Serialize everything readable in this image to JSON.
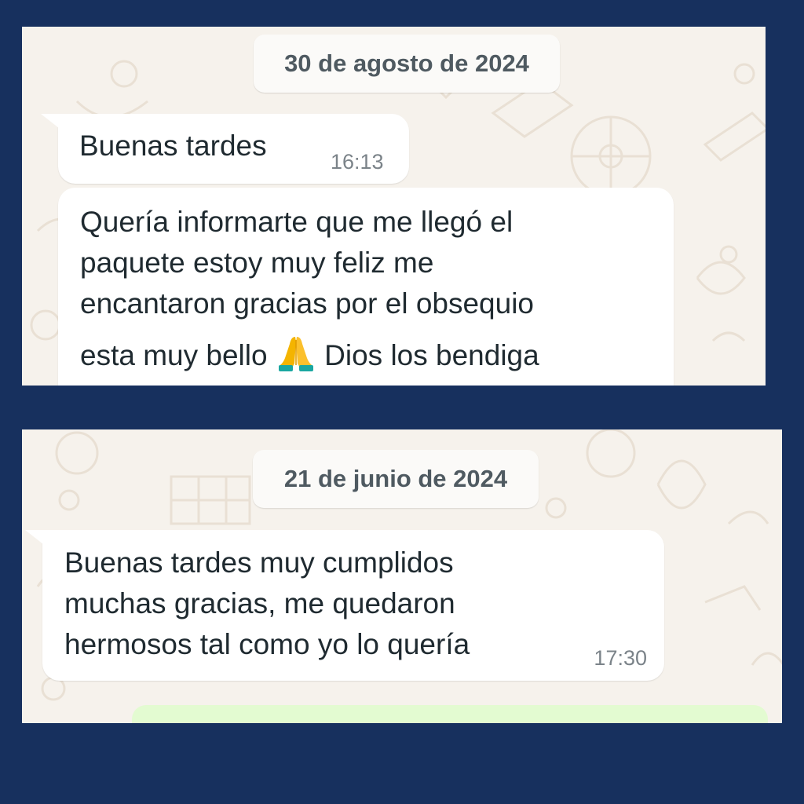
{
  "colors": {
    "frame_background": "#17305e",
    "chat_wallpaper": "#f6f2ec",
    "incoming_bubble": "#ffffff",
    "outgoing_bubble": "#e3fbd1",
    "timestamp": "#7b8389",
    "date_chip_text": "#4f5a61"
  },
  "panels": [
    {
      "date_chip": "30 de agosto de 2024",
      "messages": [
        {
          "text": "Buenas tardes",
          "time": "16:13"
        },
        {
          "lines": [
            "Quería informarte que me llegó el",
            "paquete estoy muy feliz me",
            "encantaron gracias por el obsequio"
          ],
          "last_line_before_emoji": "esta muy bello",
          "emoji": "folded-hands-icon",
          "last_line_after_emoji": "Dios los bendiga"
        }
      ]
    },
    {
      "date_chip": "21 de junio de 2024",
      "messages": [
        {
          "lines": [
            "Buenas tardes muy cumplidos",
            "muchas gracias, me quedaron",
            "hermosos tal como yo lo quería"
          ],
          "time": "17:30"
        }
      ]
    }
  ]
}
